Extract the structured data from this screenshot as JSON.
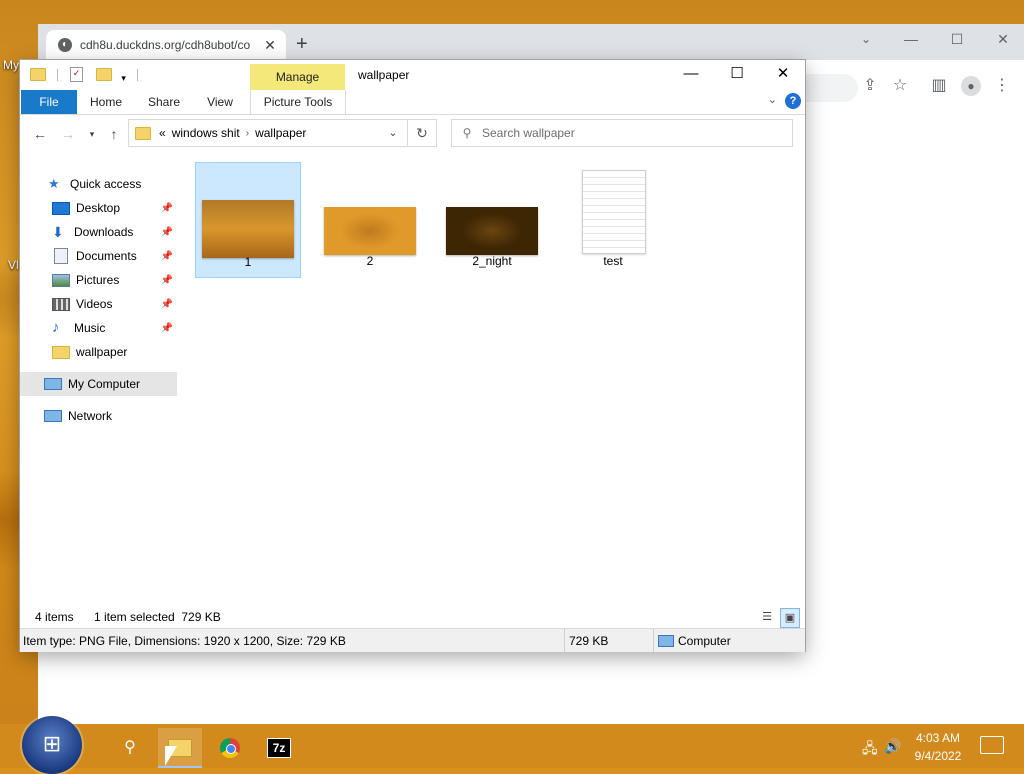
{
  "desktop": {
    "icon_labels": [
      "My",
      "Vl"
    ]
  },
  "browser": {
    "tab_title": "cdh8u.duckdns.org/cdh8ubot/co",
    "tab_close": "✕",
    "new_tab": "+",
    "win_minimize_glyph": "—",
    "win_restore_glyph": "☐",
    "win_close_glyph": "✕",
    "chevron_glyph": "⌄"
  },
  "explorer": {
    "title": "wallpaper",
    "ribbon": {
      "context_tab": "Manage",
      "tabs": [
        "File",
        "Home",
        "Share",
        "View",
        "Picture Tools"
      ]
    },
    "address": {
      "overflow": "«",
      "crumbs": [
        "windows shit",
        "wallpaper"
      ]
    },
    "search_placeholder": "Search wallpaper",
    "nav": [
      {
        "label": "Quick access",
        "icon": "star-icon",
        "pinned": false
      },
      {
        "label": "Desktop",
        "icon": "desktop-icon",
        "pinned": true
      },
      {
        "label": "Downloads",
        "icon": "download-icon",
        "pinned": true
      },
      {
        "label": "Documents",
        "icon": "documents-icon",
        "pinned": true
      },
      {
        "label": "Pictures",
        "icon": "pictures-icon",
        "pinned": true
      },
      {
        "label": "Videos",
        "icon": "videos-icon",
        "pinned": true
      },
      {
        "label": "Music",
        "icon": "music-icon",
        "pinned": true
      },
      {
        "label": "wallpaper",
        "icon": "folder-icon",
        "pinned": false
      },
      {
        "label": "My Computer",
        "icon": "computer-icon",
        "pinned": false
      },
      {
        "label": "Network",
        "icon": "network-icon",
        "pinned": false
      }
    ],
    "files": [
      {
        "name": "1",
        "type": "image",
        "selected": true,
        "thumb_color": "#c9892a"
      },
      {
        "name": "2",
        "type": "image",
        "selected": false,
        "thumb_color": "#d9901c"
      },
      {
        "name": "2_night",
        "type": "image",
        "selected": false,
        "thumb_color": "#5a3a08"
      },
      {
        "name": "test",
        "type": "text",
        "selected": false,
        "thumb_color": "#ffffff"
      }
    ],
    "status": {
      "item_count": "4 items",
      "selection": "1 item selected  729 KB",
      "details": "Item type: PNG File, Dimensions: 1920 x 1200, Size: 729 KB",
      "size": "729 KB",
      "location": "Computer"
    }
  },
  "taskbar": {
    "apps": [
      "search-icon",
      "file-explorer-icon",
      "chrome-icon",
      "7zip-icon"
    ],
    "sevenzip_label": "7z",
    "time": "4:03 AM",
    "date": "9/4/2022"
  },
  "colors": {
    "accent": "#1979ca",
    "selection": "#cce8ff",
    "manage_tab": "#f5e87a",
    "taskbar": "#d28a1c"
  }
}
